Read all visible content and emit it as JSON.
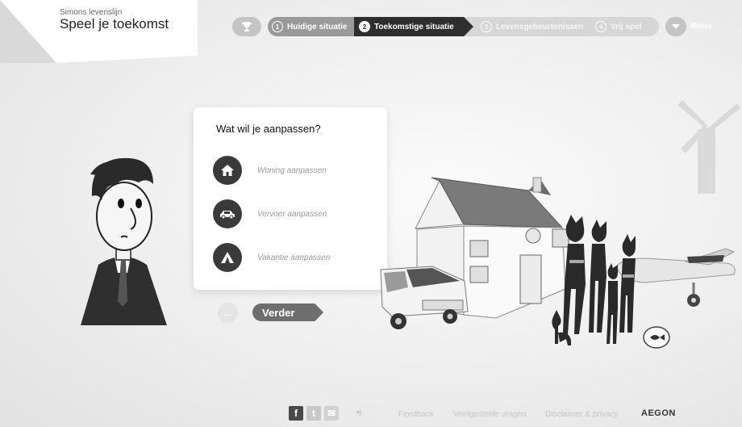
{
  "header": {
    "subtitle": "Simons levenslijn",
    "title": "Speel je toekomst"
  },
  "steps": [
    {
      "number": "1",
      "label": "Huidige situatie",
      "state": "done"
    },
    {
      "number": "2",
      "label": "Toekomstige situatie",
      "state": "active"
    },
    {
      "number": "3",
      "label": "Levensgebeurtenissen",
      "state": "upcoming"
    },
    {
      "number": "4",
      "label": "Vrij spel",
      "state": "upcoming"
    }
  ],
  "menu_label": "Menu",
  "card": {
    "question": "Wat wil je aanpassen?",
    "options": [
      {
        "label": "Woning aanpassen",
        "icon": "house-icon"
      },
      {
        "label": "Vervoer aanpassen",
        "icon": "car-icon"
      },
      {
        "label": "Vakantie aanpassen",
        "icon": "tent-icon"
      }
    ]
  },
  "nav": {
    "back_symbol": "←",
    "next_label": "Verder"
  },
  "footer": {
    "social": [
      {
        "label": "f",
        "icon": "facebook-icon"
      },
      {
        "label": "t",
        "icon": "twitter-icon"
      },
      {
        "label": "✉",
        "icon": "mail-icon"
      }
    ],
    "sound_symbol": "◂)",
    "links": [
      "Feedback",
      "Veelgestelde vragen",
      "Disclaimer & privacy"
    ],
    "logo": "AEGON"
  },
  "colors": {
    "active_step": "#2e2e2e",
    "done_step": "#9a9a9a",
    "upcoming_step": "#d6d6d6",
    "option_circle": "#3a3a3a",
    "next_button": "#6e6e6e"
  }
}
